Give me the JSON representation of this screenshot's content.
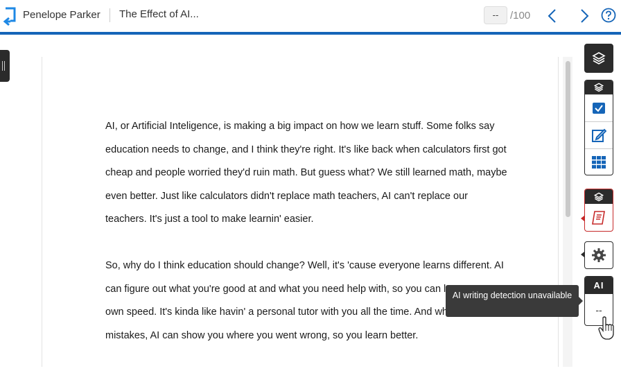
{
  "header": {
    "author": "Penelope Parker",
    "title": "The Effect of AI...",
    "grade_value": "--",
    "grade_total": "/100",
    "accent_color": "#1565b8"
  },
  "essay": {
    "paragraphs": [
      "AI, or Artificial Inteligence, is making a big impact on how we learn stuff. Some folks say education needs to change, and I think they're right. It's like back when calculators first got cheap and people worried they'd ruin math. But guess what? We still learned math, maybe even better. Just like calculators didn't replace math teachers, AI can't replace our teachers. It's just a tool to make learnin' easier.",
      "So, why do I think education should change? Well, it's 'cause everyone learns different. AI can figure out what you're good at and what you need help with, so you can learn at your own speed. It's kinda like havin' a personal tutor with you all the time. And when you make mistakes, AI can show you where you went wrong, so you learn better."
    ]
  },
  "right_panel": {
    "ai_label": "AI",
    "ai_score": "--",
    "tooltip": "AI writing detection unavailable",
    "icons": [
      "layers-icon",
      "checkbox-icon",
      "edit-icon",
      "grid-icon",
      "document-icon",
      "gear-icon"
    ]
  }
}
